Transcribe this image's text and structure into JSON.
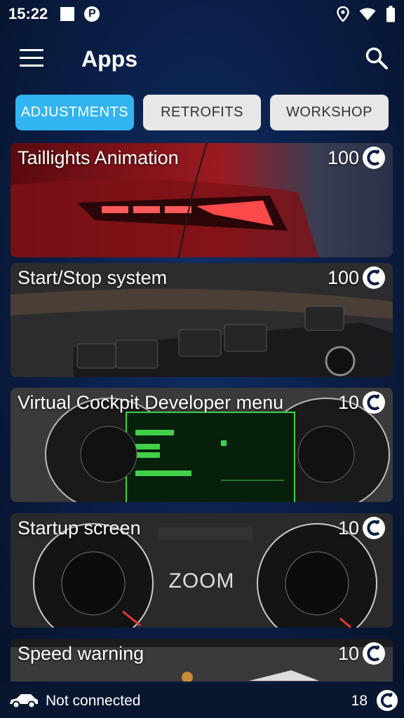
{
  "status_bar": {
    "time": "15:22"
  },
  "app_bar": {
    "title": "Apps"
  },
  "tabs": [
    {
      "label": "ADJUSTMENTS",
      "active": true
    },
    {
      "label": "RETROFITS",
      "active": false
    },
    {
      "label": "WORKSHOP",
      "active": false
    }
  ],
  "apps": [
    {
      "title": "Taillights Animation",
      "cost": "100"
    },
    {
      "title": "Start/Stop system",
      "cost": "100"
    },
    {
      "title": "Virtual Cockpit Developer menu",
      "cost": "10"
    },
    {
      "title": "Startup screen",
      "cost": "10",
      "overlay": "ZOOM"
    },
    {
      "title": "Speed warning",
      "cost": "10"
    }
  ],
  "bottom_bar": {
    "connection_status": "Not connected",
    "credits": "18"
  },
  "colors": {
    "accent": "#33b4f2",
    "background": "#0a1d44"
  },
  "icons": [
    "menu-icon",
    "search-icon",
    "coin-icon",
    "car-icon",
    "wifi-icon",
    "battery-icon",
    "location-icon"
  ]
}
